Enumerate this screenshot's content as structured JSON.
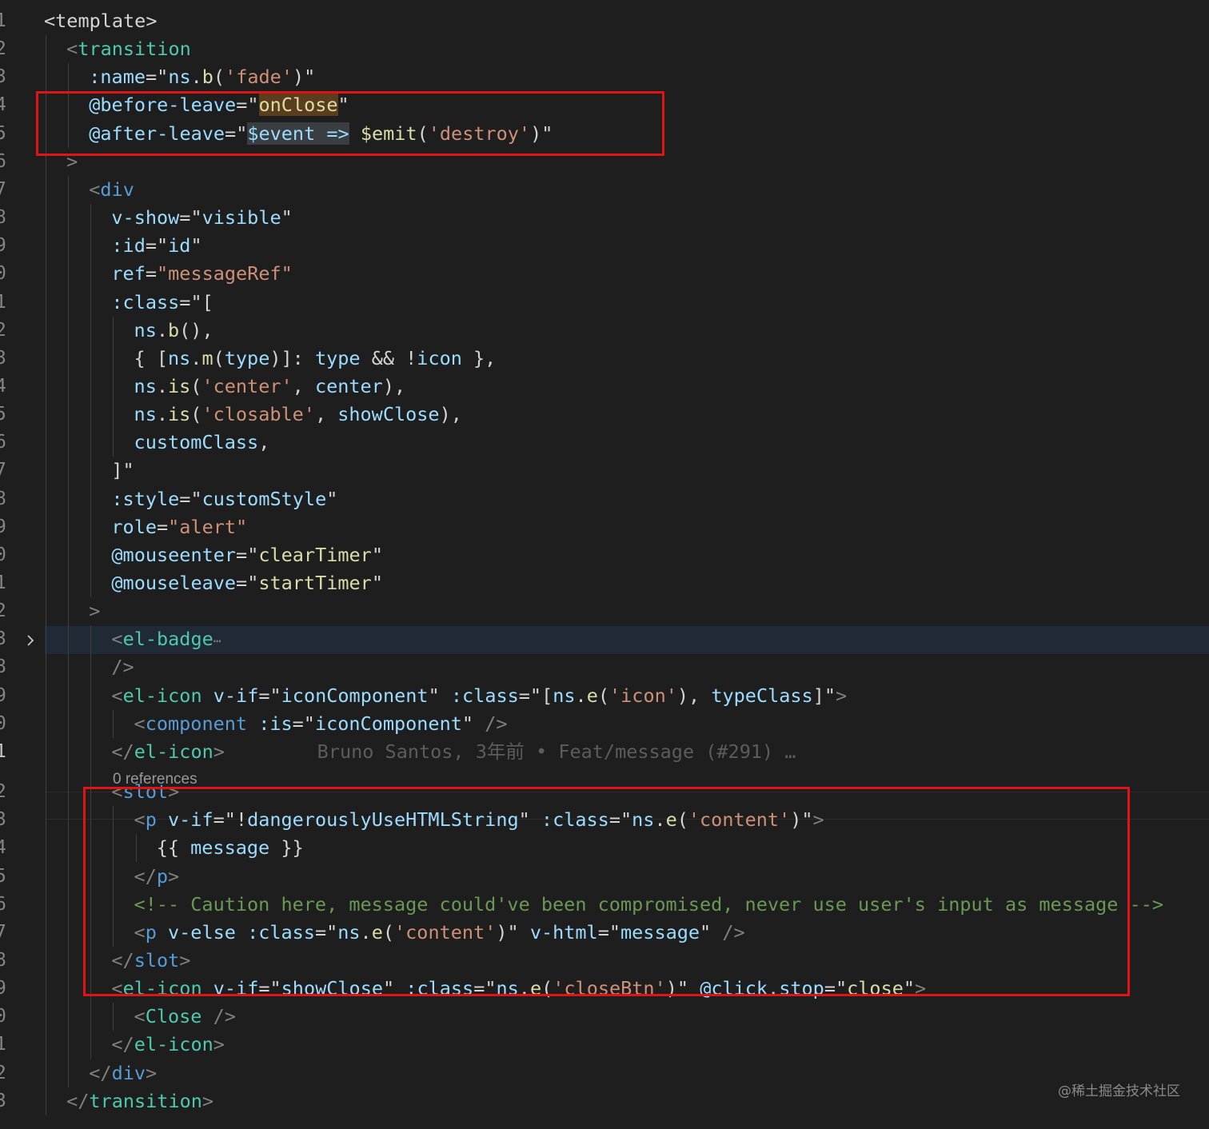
{
  "editor": {
    "line_numbers": [
      "1",
      "2",
      "3",
      "4",
      "5",
      "6",
      "7",
      "8",
      "9",
      "0",
      "1",
      "2",
      "3",
      "4",
      "5",
      "6",
      "7",
      "8",
      "9",
      "0",
      "1",
      "2",
      "3",
      "8",
      "9",
      "0",
      "1",
      "2",
      "3",
      "4",
      "5",
      "6",
      "7",
      "8",
      "9",
      "0",
      "1",
      "2",
      "3"
    ],
    "active_line_index": 26,
    "code_lens": "0 references",
    "blame": "Bruno Santos, 3年前 • Feat/message (#291) …",
    "folded_ellipsis": "⋯",
    "lines": [
      [
        [
          "pl",
          "<template>"
        ]
      ],
      [
        [
          "tag",
          "<"
        ],
        [
          "tnv",
          "transition"
        ]
      ],
      [
        [
          "at",
          ":name"
        ],
        [
          "pl",
          "=\""
        ],
        [
          "vr",
          "ns"
        ],
        [
          "pl",
          "."
        ],
        [
          "fn",
          "b"
        ],
        [
          "pl",
          "("
        ],
        [
          "st",
          "'fade'"
        ],
        [
          "pl",
          ")\""
        ]
      ],
      [
        [
          "at",
          "@before-leave"
        ],
        [
          "pl",
          "=\""
        ],
        [
          "fn",
          "onClose",
          "w"
        ],
        [
          "pl",
          "\""
        ]
      ],
      [
        [
          "at",
          "@after-leave"
        ],
        [
          "pl",
          "=\""
        ],
        [
          "vr",
          "$event =>",
          "s"
        ],
        [
          "pl",
          " "
        ],
        [
          "fn",
          "$emit"
        ],
        [
          "pl",
          "("
        ],
        [
          "st",
          "'destroy'"
        ],
        [
          "pl",
          ")\""
        ]
      ],
      [
        [
          "tag",
          ">"
        ]
      ],
      [
        [
          "tag",
          "<"
        ],
        [
          "tn",
          "div"
        ]
      ],
      [
        [
          "at",
          "v-show"
        ],
        [
          "pl",
          "=\""
        ],
        [
          "vr",
          "visible"
        ],
        [
          "pl",
          "\""
        ]
      ],
      [
        [
          "at",
          ":id"
        ],
        [
          "pl",
          "=\""
        ],
        [
          "vr",
          "id"
        ],
        [
          "pl",
          "\""
        ]
      ],
      [
        [
          "at",
          "ref"
        ],
        [
          "pl",
          "="
        ],
        [
          "st",
          "\"messageRef\""
        ]
      ],
      [
        [
          "at",
          ":class"
        ],
        [
          "pl",
          "=\"["
        ]
      ],
      [
        [
          "vr",
          "ns"
        ],
        [
          "pl",
          "."
        ],
        [
          "fn",
          "b"
        ],
        [
          "pl",
          "(),"
        ]
      ],
      [
        [
          "pl",
          "{ ["
        ],
        [
          "vr",
          "ns"
        ],
        [
          "pl",
          "."
        ],
        [
          "fn",
          "m"
        ],
        [
          "pl",
          "("
        ],
        [
          "vr",
          "type"
        ],
        [
          "pl",
          ")]: "
        ],
        [
          "vr",
          "type"
        ],
        [
          "pl",
          " && !"
        ],
        [
          "vr",
          "icon"
        ],
        [
          "pl",
          " },"
        ]
      ],
      [
        [
          "vr",
          "ns"
        ],
        [
          "pl",
          "."
        ],
        [
          "fn",
          "is"
        ],
        [
          "pl",
          "("
        ],
        [
          "st",
          "'center'"
        ],
        [
          "pl",
          ", "
        ],
        [
          "vr",
          "center"
        ],
        [
          "pl",
          "),"
        ]
      ],
      [
        [
          "vr",
          "ns"
        ],
        [
          "pl",
          "."
        ],
        [
          "fn",
          "is"
        ],
        [
          "pl",
          "("
        ],
        [
          "st",
          "'closable'"
        ],
        [
          "pl",
          ", "
        ],
        [
          "vr",
          "showClose"
        ],
        [
          "pl",
          "),"
        ]
      ],
      [
        [
          "vr",
          "customClass"
        ],
        [
          "pl",
          ","
        ]
      ],
      [
        [
          "pl",
          "]\""
        ]
      ],
      [
        [
          "at",
          ":style"
        ],
        [
          "pl",
          "=\""
        ],
        [
          "vr",
          "customStyle"
        ],
        [
          "pl",
          "\""
        ]
      ],
      [
        [
          "at",
          "role"
        ],
        [
          "pl",
          "="
        ],
        [
          "st",
          "\"alert\""
        ]
      ],
      [
        [
          "at",
          "@mouseenter"
        ],
        [
          "pl",
          "=\""
        ],
        [
          "fn",
          "clearTimer"
        ],
        [
          "pl",
          "\""
        ]
      ],
      [
        [
          "at",
          "@mouseleave"
        ],
        [
          "pl",
          "=\""
        ],
        [
          "fn",
          "startTimer"
        ],
        [
          "pl",
          "\""
        ]
      ],
      [
        [
          "tag",
          ">"
        ]
      ],
      [
        [
          "tag",
          "<"
        ],
        [
          "tnv",
          "el-badge"
        ]
      ],
      [
        [
          "tag",
          "/>"
        ]
      ],
      [
        [
          "tag",
          "<"
        ],
        [
          "tnv",
          "el-icon"
        ],
        [
          "pl",
          " "
        ],
        [
          "at",
          "v-if"
        ],
        [
          "pl",
          "=\""
        ],
        [
          "vr",
          "iconComponent"
        ],
        [
          "pl",
          "\" "
        ],
        [
          "at",
          ":class"
        ],
        [
          "pl",
          "=\"["
        ],
        [
          "vr",
          "ns"
        ],
        [
          "pl",
          "."
        ],
        [
          "fn",
          "e"
        ],
        [
          "pl",
          "("
        ],
        [
          "st",
          "'icon'"
        ],
        [
          "pl",
          "), "
        ],
        [
          "vr",
          "typeClass"
        ],
        [
          "pl",
          "]\""
        ],
        [
          "tag",
          ">"
        ]
      ],
      [
        [
          "tag",
          "<"
        ],
        [
          "tn",
          "component"
        ],
        [
          "pl",
          " "
        ],
        [
          "at",
          ":is"
        ],
        [
          "pl",
          "=\""
        ],
        [
          "vr",
          "iconComponent"
        ],
        [
          "pl",
          "\" "
        ],
        [
          "tag",
          "/>"
        ]
      ],
      [
        [
          "tag",
          "</"
        ],
        [
          "tnv",
          "el-icon"
        ],
        [
          "tag",
          ">"
        ]
      ],
      [
        [
          "tag",
          "<"
        ],
        [
          "tn",
          "slot"
        ],
        [
          "tag",
          ">"
        ]
      ],
      [
        [
          "tag",
          "<"
        ],
        [
          "tn",
          "p"
        ],
        [
          "pl",
          " "
        ],
        [
          "at",
          "v-if"
        ],
        [
          "pl",
          "=\"!"
        ],
        [
          "vr",
          "dangerouslyUseHTMLString"
        ],
        [
          "pl",
          "\" "
        ],
        [
          "at",
          ":class"
        ],
        [
          "pl",
          "=\""
        ],
        [
          "vr",
          "ns"
        ],
        [
          "pl",
          "."
        ],
        [
          "fn",
          "e"
        ],
        [
          "pl",
          "("
        ],
        [
          "st",
          "'content'"
        ],
        [
          "pl",
          ")\""
        ],
        [
          "tag",
          ">"
        ]
      ],
      [
        [
          "pl",
          "{{ "
        ],
        [
          "vr",
          "message"
        ],
        [
          "pl",
          " }}"
        ]
      ],
      [
        [
          "tag",
          "</"
        ],
        [
          "tn",
          "p"
        ],
        [
          "tag",
          ">"
        ]
      ],
      [
        [
          "cm",
          "<!-- Caution here, message could've been compromised, never use user's input as message -->"
        ]
      ],
      [
        [
          "tag",
          "<"
        ],
        [
          "tn",
          "p"
        ],
        [
          "pl",
          " "
        ],
        [
          "at",
          "v-else"
        ],
        [
          "pl",
          " "
        ],
        [
          "at",
          ":class"
        ],
        [
          "pl",
          "=\""
        ],
        [
          "vr",
          "ns"
        ],
        [
          "pl",
          "."
        ],
        [
          "fn",
          "e"
        ],
        [
          "pl",
          "("
        ],
        [
          "st",
          "'content'"
        ],
        [
          "pl",
          ")\" "
        ],
        [
          "at",
          "v-html"
        ],
        [
          "pl",
          "=\""
        ],
        [
          "vr",
          "message"
        ],
        [
          "pl",
          "\" "
        ],
        [
          "tag",
          "/>"
        ]
      ],
      [
        [
          "tag",
          "</"
        ],
        [
          "tn",
          "slot"
        ],
        [
          "tag",
          ">"
        ]
      ],
      [
        [
          "tag",
          "<"
        ],
        [
          "tnv",
          "el-icon"
        ],
        [
          "pl",
          " "
        ],
        [
          "at",
          "v-if"
        ],
        [
          "pl",
          "=\""
        ],
        [
          "vr",
          "showClose"
        ],
        [
          "pl",
          "\" "
        ],
        [
          "at",
          ":class"
        ],
        [
          "pl",
          "=\""
        ],
        [
          "vr",
          "ns"
        ],
        [
          "pl",
          "."
        ],
        [
          "fn",
          "e"
        ],
        [
          "pl",
          "("
        ],
        [
          "st",
          "'closeBtn'"
        ],
        [
          "pl",
          ")\" "
        ],
        [
          "at",
          "@click.stop"
        ],
        [
          "pl",
          "=\""
        ],
        [
          "fn",
          "close"
        ],
        [
          "pl",
          "\""
        ],
        [
          "tag",
          ">"
        ]
      ],
      [
        [
          "tag",
          "<"
        ],
        [
          "tnv",
          "Close"
        ],
        [
          "pl",
          " "
        ],
        [
          "tag",
          "/>"
        ]
      ],
      [
        [
          "tag",
          "</"
        ],
        [
          "tnv",
          "el-icon"
        ],
        [
          "tag",
          ">"
        ]
      ],
      [
        [
          "tag",
          "</"
        ],
        [
          "tn",
          "div"
        ],
        [
          "tag",
          ">"
        ]
      ],
      [
        [
          "tag",
          "</"
        ],
        [
          "tnv",
          "transition"
        ],
        [
          "tag",
          ">"
        ]
      ]
    ]
  },
  "watermark": "@稀土掘金技术社区",
  "colors": {
    "background": "#1e1e1e",
    "highlight_box": "#e01414",
    "folded_row": "#1f2a36"
  }
}
